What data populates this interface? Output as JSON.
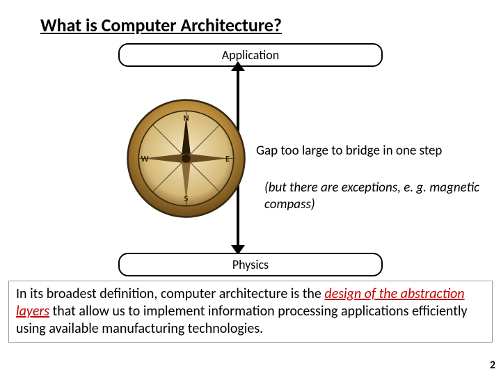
{
  "title": "What is Computer Architecture?",
  "topBox": "Application",
  "bottomBox": "Physics",
  "gapLine": "Gap too large to bridge in one step",
  "gapSub": "(but there are exceptions, e. g. magnetic compass)",
  "defPre": "In its broadest definition, computer architecture is the ",
  "defEm": "design of the abstraction layers",
  "defPost": " that allow us to implement information processing applications efficiently using available manufacturing technologies.",
  "pageNumber": "2"
}
